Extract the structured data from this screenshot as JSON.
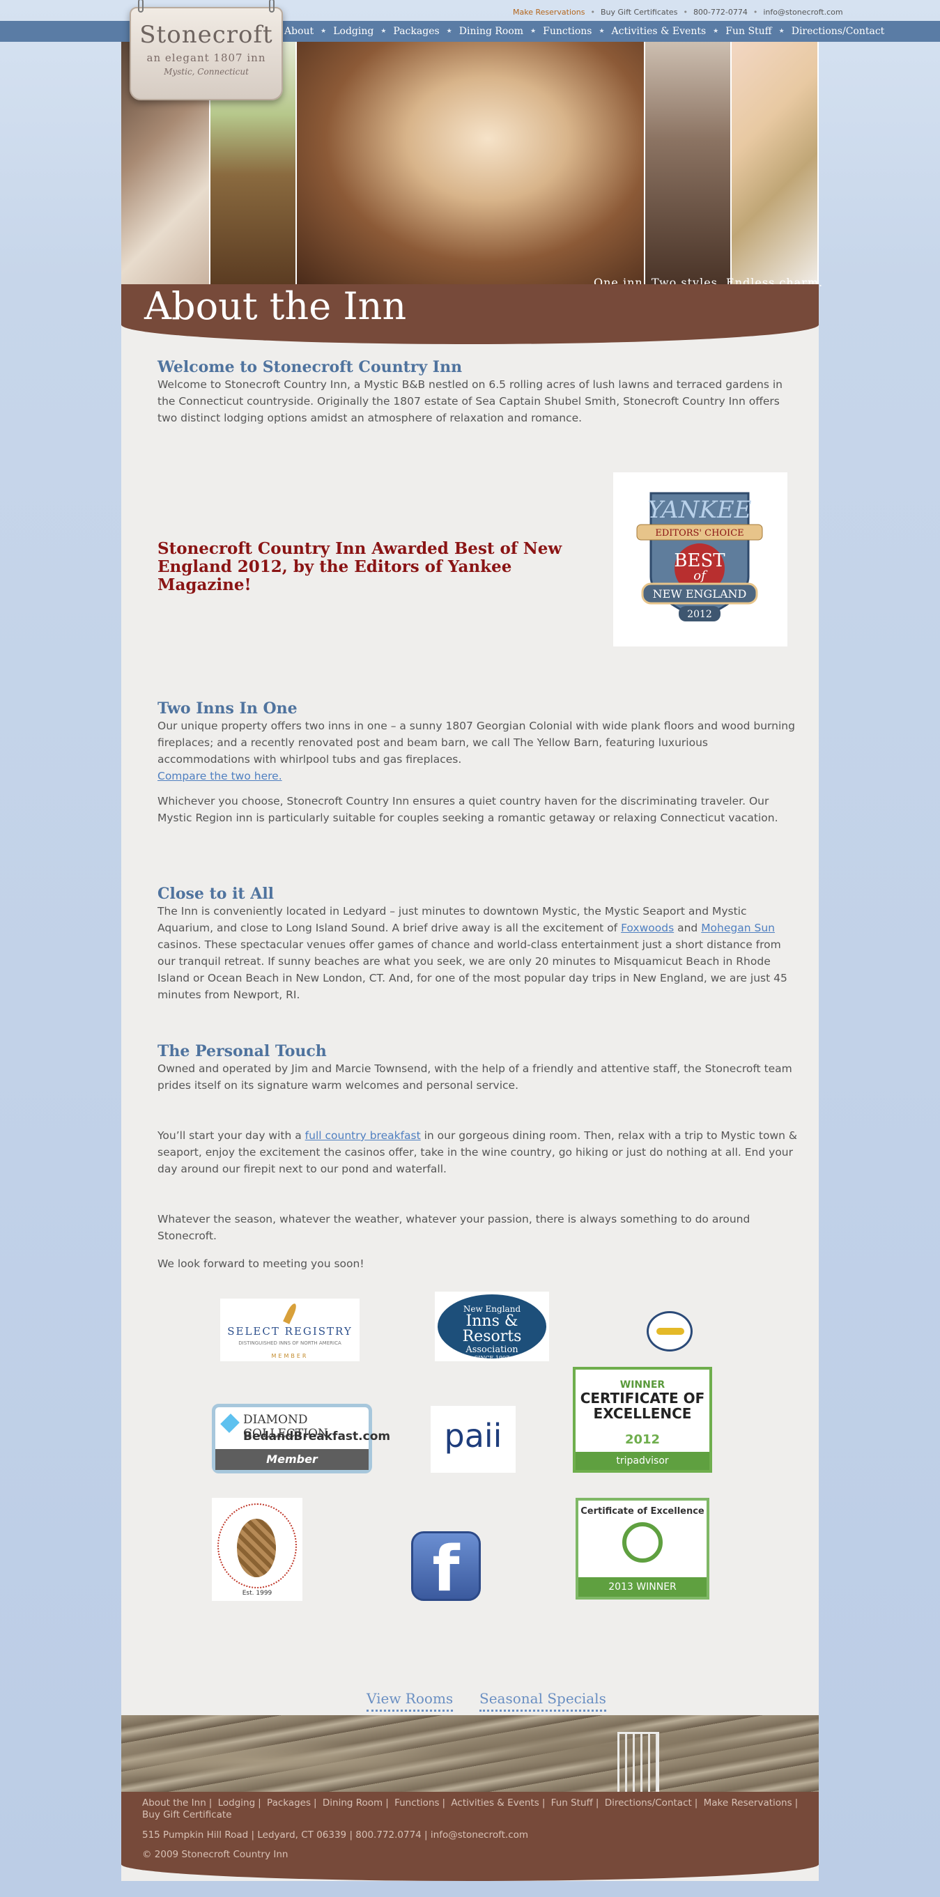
{
  "top_links": {
    "reservations": "Make Reservations",
    "gift": "Buy Gift Certificates",
    "phone": "800-772-0774",
    "email": "info@stonecroft.com"
  },
  "logo": {
    "name": "Stonecroft",
    "subtitle": "an elegant 1807 inn",
    "location": "Mystic, Connecticut"
  },
  "nav": [
    "About",
    "Lodging",
    "Packages",
    "Dining Room",
    "Functions",
    "Activities & Events",
    "Fun Stuff",
    "Directions/Contact"
  ],
  "hero": {
    "tagline": "One inn. Two styles. Endless charm."
  },
  "page_title": "About the Inn",
  "welcome": {
    "heading": "Welcome to Stonecroft Country Inn",
    "text": "Welcome to Stonecroft Country Inn, a Mystic B&B nestled on 6.5 rolling acres of lush lawns and terraced gardens in the Connecticut countryside. Originally the 1807 estate of Sea Captain Shubel Smith, Stonecroft Country Inn offers two distinct lodging options amidst an atmosphere of relaxation and romance."
  },
  "award": {
    "text": "Stonecroft Country Inn Awarded Best of New England 2012, by the Editors of Yankee Magazine!",
    "badge": {
      "yankee": "YANKEE",
      "editors": "EDITORS' CHOICE",
      "best": "BEST",
      "of": "of",
      "ne": "NEW ENGLAND",
      "year": "2012"
    }
  },
  "two_inns": {
    "heading": "Two Inns In One",
    "text": "Our unique property offers two inns in one – a sunny 1807 Georgian Colonial with wide plank floors and wood burning fireplaces; and a recently renovated post and beam barn, we call The Yellow Barn, featuring luxurious accommodations with whirlpool tubs and gas fireplaces.",
    "link": "Compare the two here.",
    "text2": "Whichever you choose, Stonecroft Country Inn ensures a quiet country haven for the discriminating traveler. Our Mystic Region inn is particularly suitable for couples seeking a romantic getaway or relaxing Connecticut vacation."
  },
  "close": {
    "heading": "Close to it All",
    "text_a": "The Inn is conveniently located in Ledyard – just minutes to downtown Mystic, the Mystic Seaport and Mystic Aquarium, and close to Long Island Sound. A brief drive away is all the excitement of ",
    "link_foxwoods": "Foxwoods",
    "and": " and ",
    "link_mohegan": "Mohegan Sun",
    "text_b": " casinos. These spectacular venues offer games of chance and world-class entertainment just a short distance from our tranquil retreat. If sunny beaches are what you seek, we are only 20 minutes to Misquamicut Beach in Rhode Island or Ocean Beach in New London, CT. And, for one of the most popular day trips in New England, we are just 45 minutes from Newport, RI."
  },
  "personal": {
    "heading": "The Personal Touch",
    "text": "Owned and operated by Jim and Marcie Townsend, with the help of a friendly and attentive staff, the Stonecroft team prides itself on its signature warm welcomes and personal service.",
    "text2_a": "You’ll start your day with a ",
    "link_breakfast": "full country breakfast",
    "text2_b": " in our gorgeous dining room.  Then, relax with a trip to Mystic town & seaport, enjoy the excitement the casinos offer, take in the wine country, go hiking or just do nothing at all. End your day around our firepit next to our pond and waterfall.",
    "text3": "Whatever the season, whatever the weather, whatever your passion, there is always something to do around Stonecroft.",
    "text4": "We look forward to meeting you soon!"
  },
  "logos": {
    "select": {
      "title": "SELECT REGISTRY",
      "sub": "DISTINGUISHED INNS OF NORTH AMERICA",
      "member": "MEMBER"
    },
    "neira": {
      "l1": "New England",
      "l2": "Inns & Resorts",
      "l3": "Association",
      "l4": "SINCE 1907"
    },
    "diamond": {
      "title": "DIAMOND COLLECTION",
      "site": "BedandBreakfast.com",
      "member": "Member"
    },
    "paii": {
      "text": "paii"
    },
    "cert2012": {
      "winner": "WINNER",
      "title": "CERTIFICATE OF EXCELLENCE",
      "year": "2012",
      "brand": "tripadvisor"
    },
    "pineapple": {
      "est": "Est. 1999"
    },
    "facebook": {
      "glyph": "f"
    },
    "cert2013": {
      "title": "Certificate of Excellence",
      "bar": "2013 WINNER"
    }
  },
  "cta": {
    "rooms": "View Rooms",
    "specials": "Seasonal Specials"
  },
  "footer": {
    "links": [
      "About the Inn",
      "Lodging",
      "Packages",
      "Dining Room",
      "Functions",
      "Activities & Events",
      "Fun Stuff",
      "Directions/Contact",
      "Make Reservations",
      "Buy Gift Certificate"
    ],
    "address": "515 Pumpkin Hill Road | Ledyard, CT 06339 | 800.772.0774 | info@stonecroft.com",
    "copyright": "© 2009 Stonecroft Country Inn"
  },
  "colors": {
    "nav": "#5a7ca5",
    "banner": "#774a3a",
    "heading": "#4f739e",
    "award": "#8a1414",
    "link": "#4f7fc0"
  }
}
